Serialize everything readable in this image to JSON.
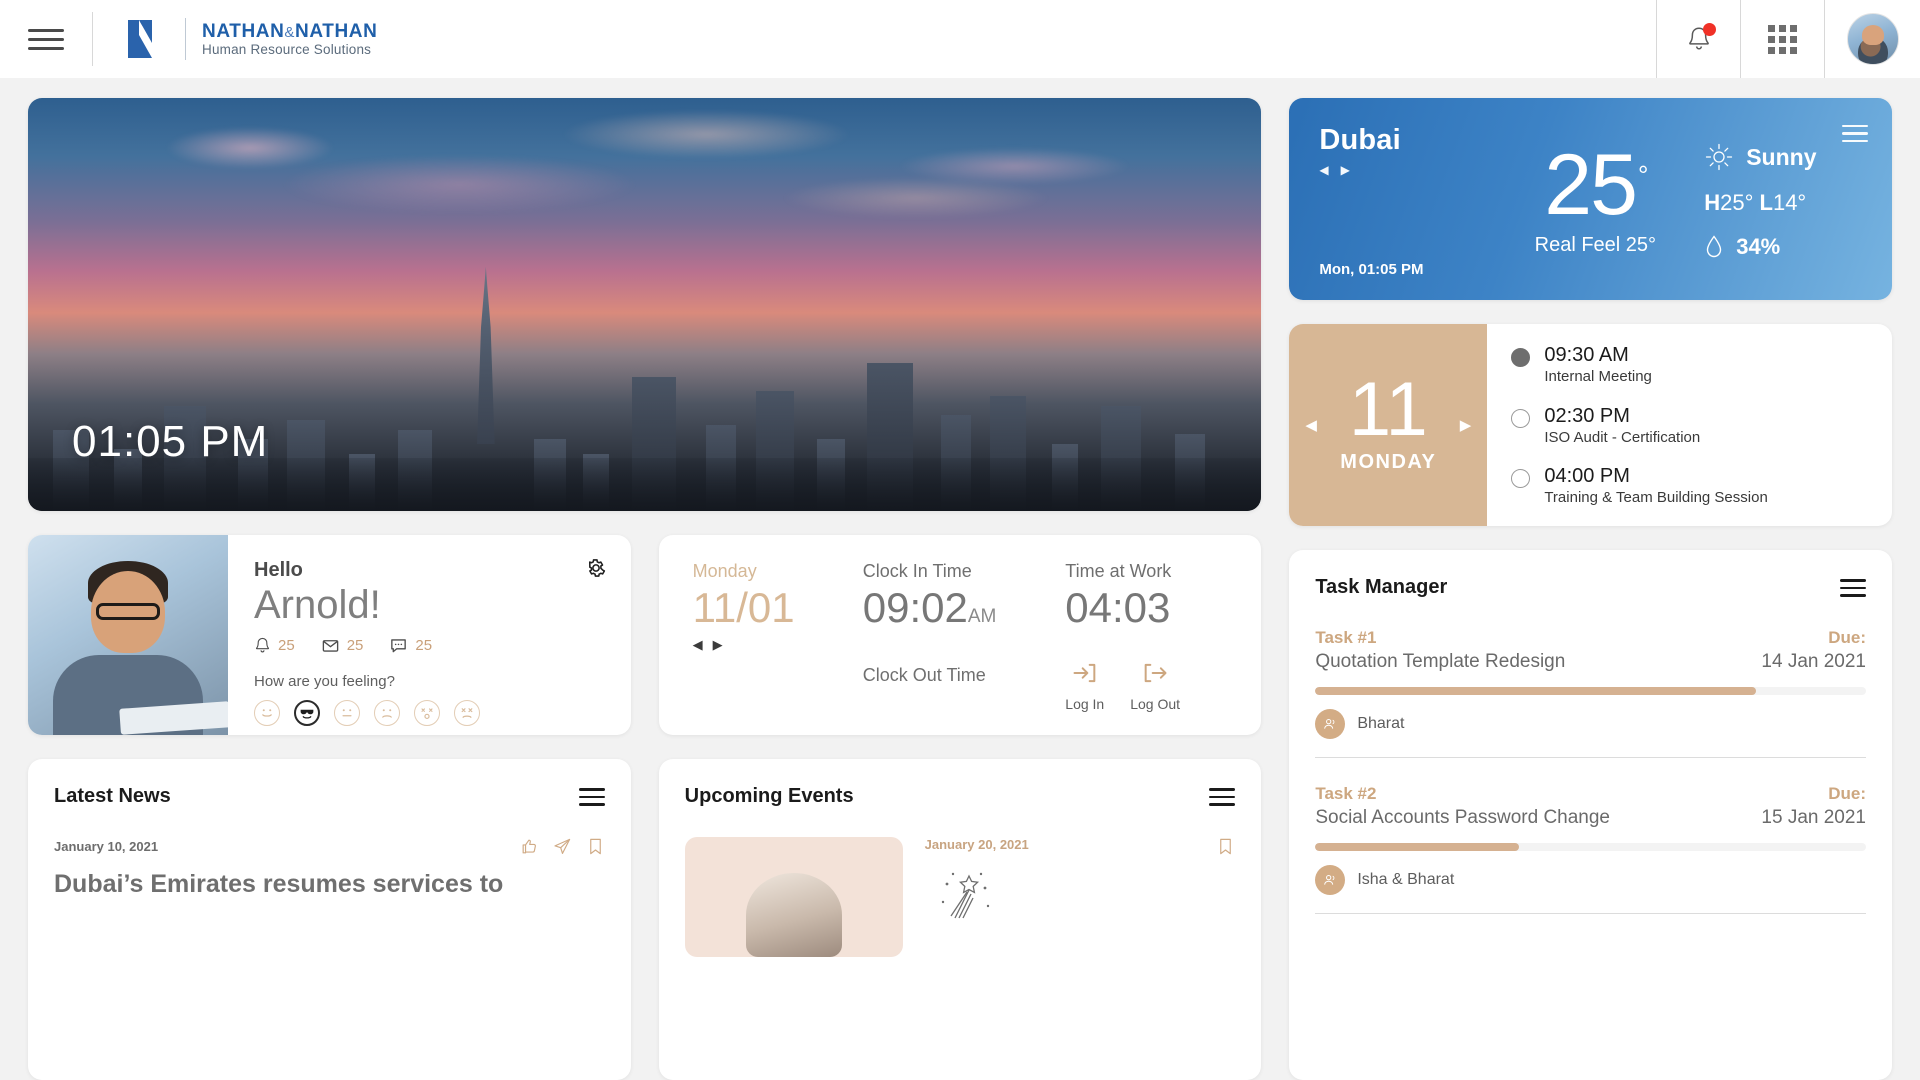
{
  "header": {
    "menu_icon": "hamburger-icon",
    "brand_name_1": "NATHAN",
    "brand_amp": "&",
    "brand_name_2": "NATHAN",
    "brand_tagline": "Human Resource Solutions",
    "notifications_icon": "bell-icon",
    "apps_icon": "grid-icon",
    "avatar_icon": "user-avatar"
  },
  "hero": {
    "time": "01:05 PM"
  },
  "weather": {
    "city": "Dubai",
    "prev_icon": "chevron-left-icon",
    "next_icon": "chevron-right-icon",
    "timestamp": "Mon, 01:05 PM",
    "temperature": "25",
    "degree": "°",
    "real_feel": "Real Feel 25°",
    "condition": "Sunny",
    "condition_icon": "sun-icon",
    "high_label": "H",
    "high_value": "25°",
    "low_label": "L",
    "low_value": "14°",
    "humidity": "34%",
    "humidity_icon": "droplet-icon",
    "menu_icon": "hamburger-icon",
    "accent_color": "#3d83c6"
  },
  "agenda": {
    "day_number": "11",
    "day_name": "MONDAY",
    "prev_icon": "triangle-left-icon",
    "next_icon": "triangle-right-icon",
    "items": [
      {
        "time": "09:30 AM",
        "desc": "Internal Meeting",
        "done": true
      },
      {
        "time": "02:30 PM",
        "desc": "ISO Audit - Certification",
        "done": false
      },
      {
        "time": "04:00 PM",
        "desc": "Training & Team Building Session",
        "done": false
      }
    ]
  },
  "greeting": {
    "hello": "Hello",
    "name": "Arnold!",
    "settings_icon": "gear-icon",
    "stats": [
      {
        "icon": "bell-icon",
        "count": "25"
      },
      {
        "icon": "envelope-icon",
        "count": "25"
      },
      {
        "icon": "chat-icon",
        "count": "25"
      }
    ],
    "mood_question": "How are you feeling?",
    "moods": [
      {
        "name": "happy-face-icon",
        "selected": false
      },
      {
        "name": "cool-face-icon",
        "selected": true
      },
      {
        "name": "neutral-face-icon",
        "selected": false
      },
      {
        "name": "sad-face-icon",
        "selected": false
      },
      {
        "name": "surprised-face-icon",
        "selected": false
      },
      {
        "name": "upset-face-icon",
        "selected": false
      }
    ]
  },
  "clock": {
    "day_label": "Monday",
    "date_value": "11/01",
    "prev_icon": "triangle-left-icon",
    "next_icon": "triangle-right-icon",
    "clock_in_label": "Clock In Time",
    "clock_in_value": "09:02",
    "clock_in_ampm": "AM",
    "clock_out_label": "Clock Out Time",
    "clock_out_value": "",
    "time_at_work_label": "Time at Work",
    "time_at_work_value": "04:03",
    "login_label": "Log In",
    "login_icon": "login-arrow-icon",
    "logout_label": "Log Out",
    "logout_icon": "logout-arrow-icon"
  },
  "tasks": {
    "title": "Task Manager",
    "menu_icon": "hamburger-icon",
    "due_label": "Due:",
    "items": [
      {
        "id": "Task #1",
        "name": "Quotation Template Redesign",
        "due": "14 Jan 2021",
        "progress": 80,
        "owner": "Bharat",
        "owner_icon": "users-icon"
      },
      {
        "id": "Task #2",
        "name": "Social Accounts Password Change",
        "due": "15 Jan 2021",
        "progress": 37,
        "owner": "Isha & Bharat",
        "owner_icon": "users-icon"
      }
    ]
  },
  "news": {
    "title": "Latest News",
    "menu_icon": "hamburger-icon",
    "date": "January 10, 2021",
    "headline": "Dubai’s Emirates resumes services to",
    "actions": [
      {
        "name": "like-icon"
      },
      {
        "name": "share-icon"
      },
      {
        "name": "bookmark-icon"
      }
    ]
  },
  "events": {
    "title": "Upcoming Events",
    "menu_icon": "hamburger-icon",
    "date": "January 20, 2021",
    "bookmark_icon": "bookmark-icon",
    "celebration_icon": "confetti-icon"
  }
}
